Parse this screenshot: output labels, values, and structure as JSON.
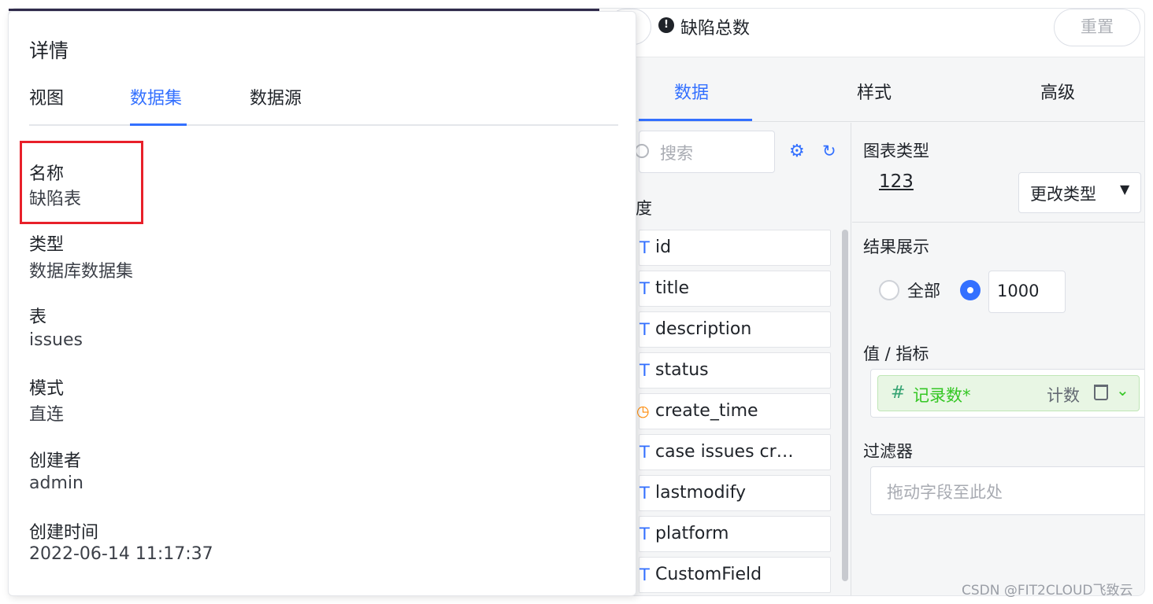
{
  "editor": {
    "chart_title": "缺陷总数",
    "reset_label": "重置",
    "tabs": [
      "数据",
      "样式",
      "高级"
    ],
    "search_placeholder": "搜索",
    "dimension_label": "度",
    "fields": [
      {
        "type": "T",
        "name": "id"
      },
      {
        "type": "T",
        "name": "title"
      },
      {
        "type": "T",
        "name": "description"
      },
      {
        "type": "T",
        "name": "status"
      },
      {
        "type": "time",
        "name": "create_time"
      },
      {
        "type": "T",
        "name": "case issues cr…"
      },
      {
        "type": "T",
        "name": "lastmodify"
      },
      {
        "type": "T",
        "name": "platform"
      },
      {
        "type": "T",
        "name": "CustomField"
      }
    ],
    "chart_type_title": "图表类型",
    "chart_type_icon": "123",
    "change_type_label": "更改类型",
    "result_title": "结果展示",
    "result_all": "全部",
    "result_limit": "1000",
    "metric_title": "值 / 指标",
    "metric_name": "记录数*",
    "metric_agg": "计数",
    "filter_title": "过滤器",
    "filter_placeholder": "拖动字段至此处",
    "colors": {
      "accent": "#3370ff",
      "metric_bg": "#e8f6e4",
      "metric_text": "#34c724",
      "time_icon": "#ff8800"
    }
  },
  "detail": {
    "title": "详情",
    "tabs": [
      "视图",
      "数据集",
      "数据源"
    ],
    "active_tab": "数据集",
    "props": [
      {
        "label": "名称",
        "value": "缺陷表"
      },
      {
        "label": "类型",
        "value": "数据库数据集"
      },
      {
        "label": "表",
        "value": "issues"
      },
      {
        "label": "模式",
        "value": "直连"
      },
      {
        "label": "创建者",
        "value": "admin"
      },
      {
        "label": "创建时间",
        "value": "2022-06-14 11:17:37"
      }
    ],
    "highlight_color": "#e8202a"
  },
  "watermark": "CSDN @FIT2CLOUD飞致云"
}
